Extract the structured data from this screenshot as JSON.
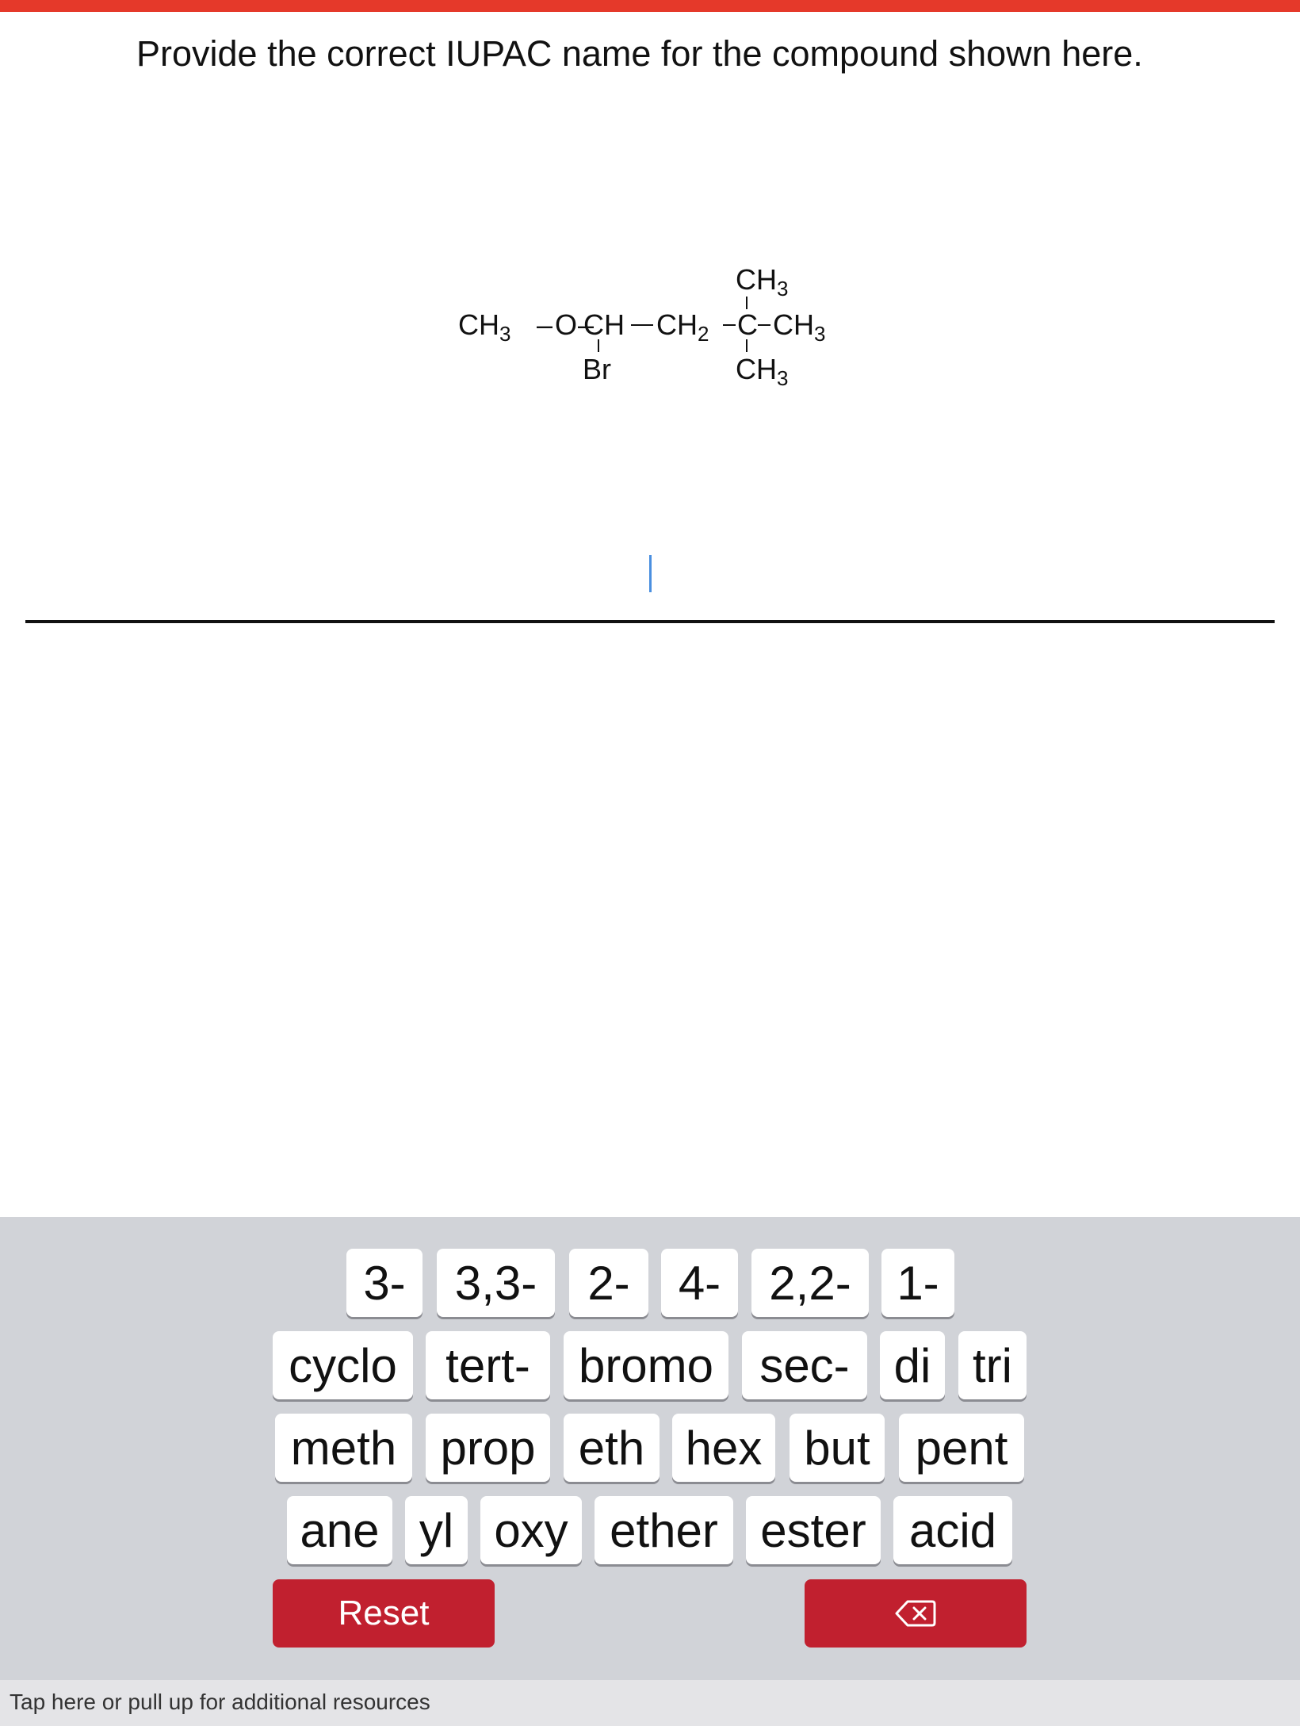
{
  "colors": {
    "accent": "#e5392a",
    "button_red": "#c1202f",
    "keyboard_bg": "#d1d3d8",
    "cursor": "#4a8fe0"
  },
  "question": {
    "text": "Provide the correct IUPAC name for the compound shown here."
  },
  "structure": {
    "main_chain": [
      "CH3",
      "O",
      "CH",
      "CH2",
      "C",
      "CH3"
    ],
    "substituents": {
      "ch_below": "Br",
      "c_above": "CH3",
      "c_below": "CH3"
    }
  },
  "answer": {
    "value": ""
  },
  "keyboard": {
    "row1": [
      "3-",
      "3,3-",
      "2-",
      "4-",
      "2,2-",
      "1-"
    ],
    "row2": [
      "cyclo",
      "tert-",
      "bromo",
      "sec-",
      "di",
      "tri"
    ],
    "row3": [
      "meth",
      "prop",
      "eth",
      "hex",
      "but",
      "pent"
    ],
    "row4": [
      "ane",
      "yl",
      "oxy",
      "ether",
      "ester",
      "acid"
    ],
    "reset_label": "Reset",
    "backspace_icon": "backspace-icon"
  },
  "resources": {
    "text": "Tap here or pull up for additional resources"
  }
}
